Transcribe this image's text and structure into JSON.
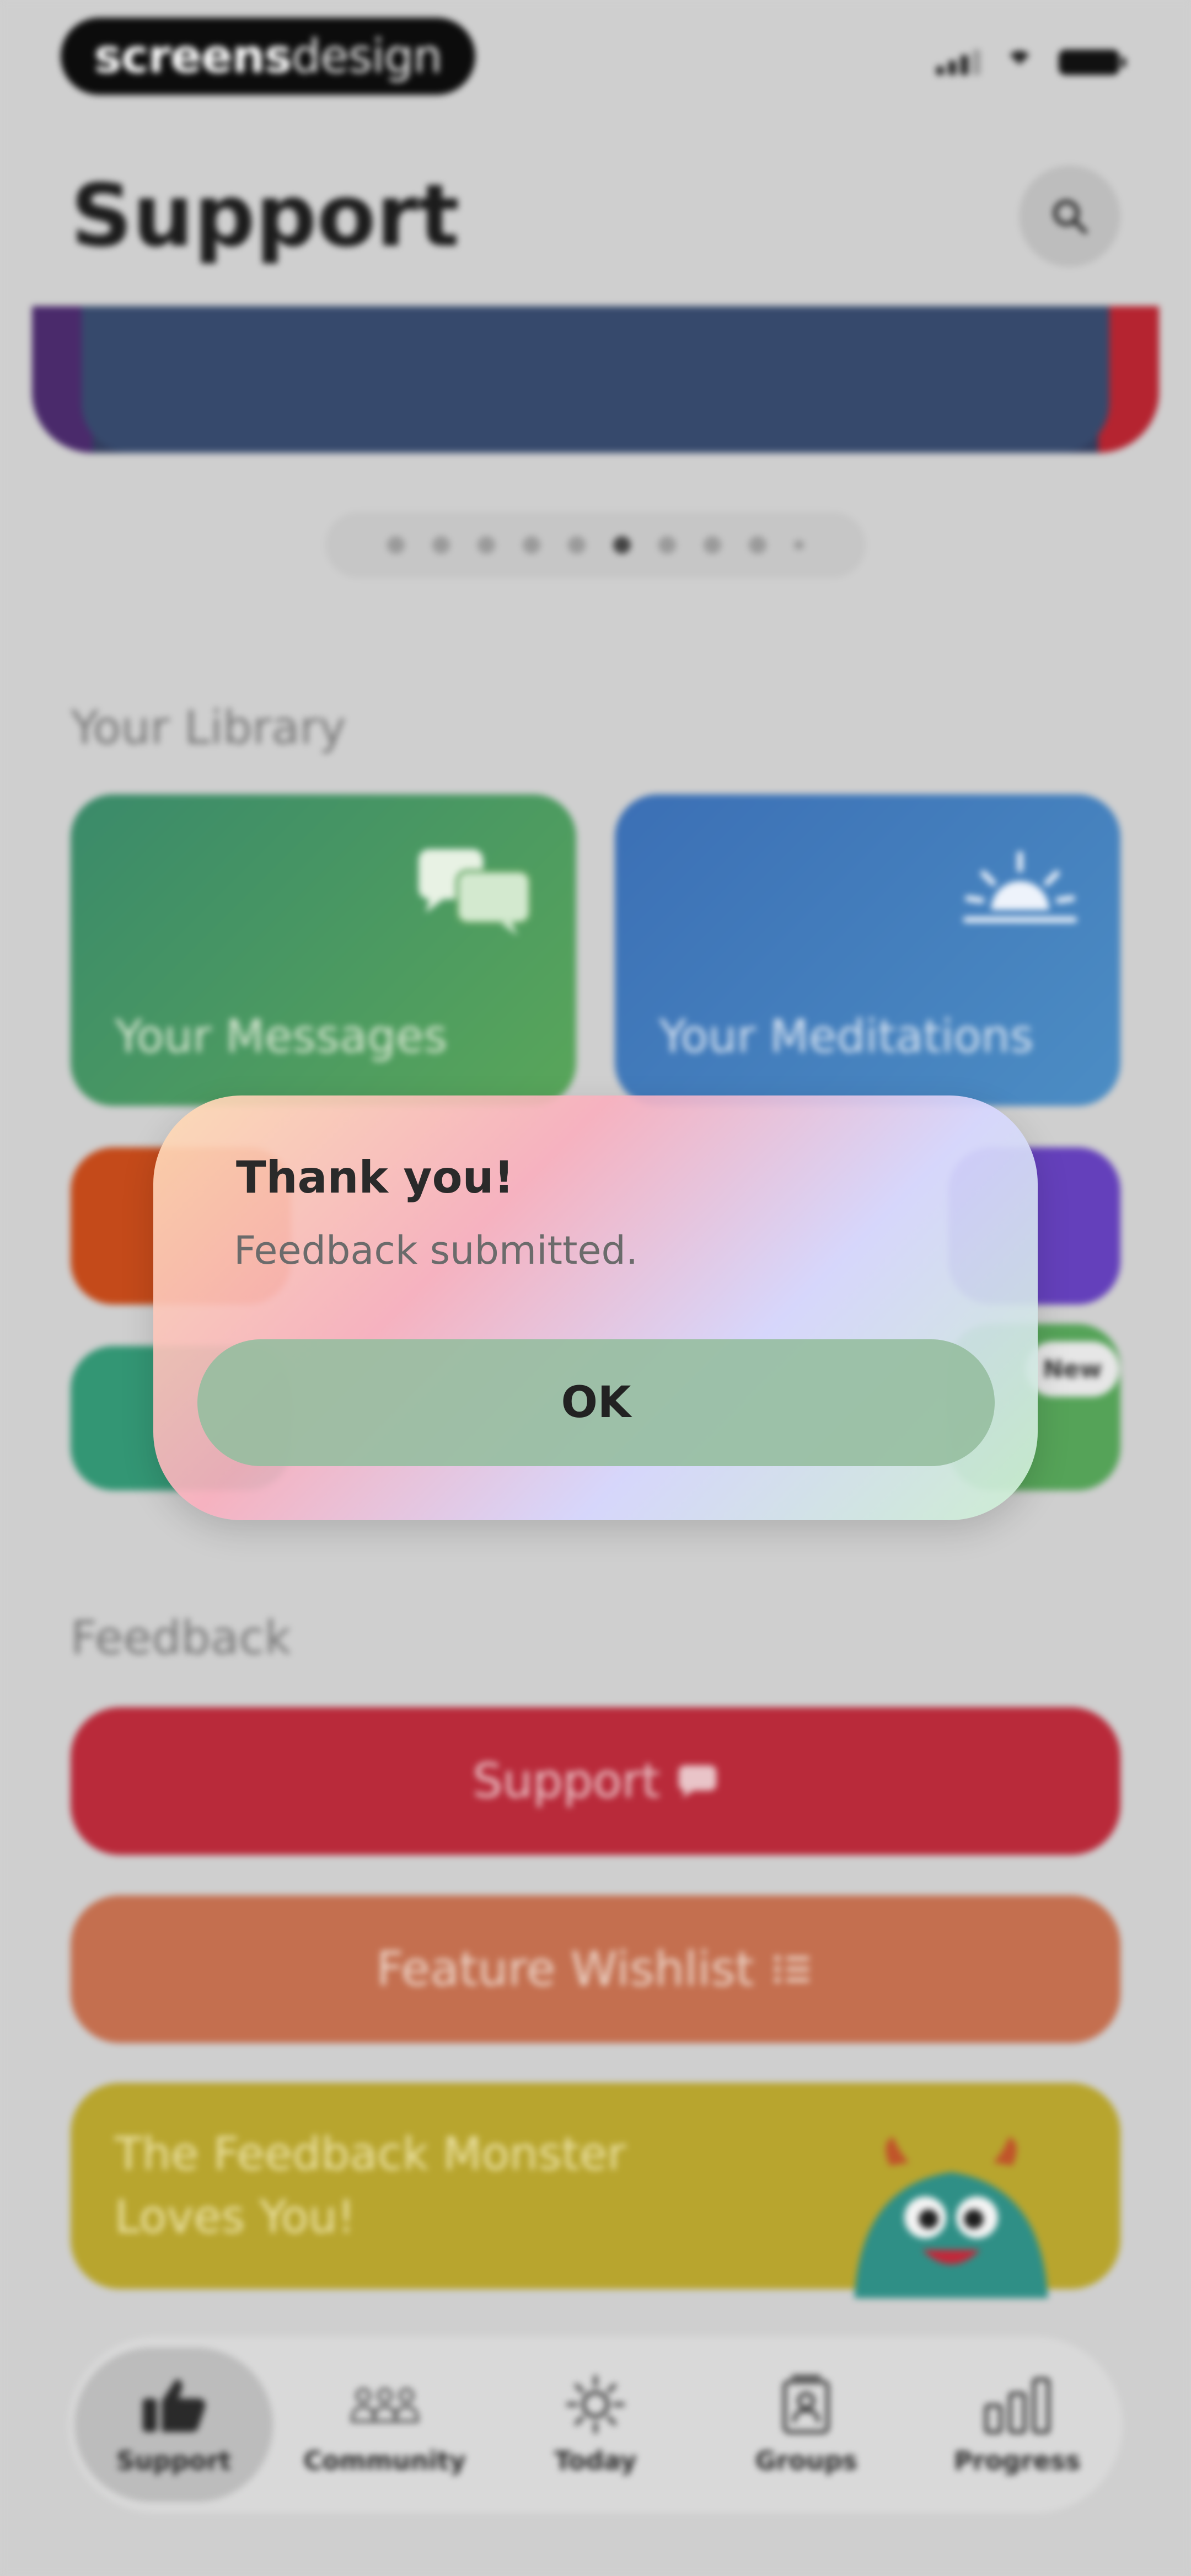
{
  "status_bar": {
    "brand_bold": "screens",
    "brand_light": "design"
  },
  "header": {
    "title": "Support"
  },
  "library": {
    "label": "Your Library",
    "messages_label": "Your Messages",
    "meditations_label": "Your Meditations",
    "new_badge": "New"
  },
  "feedback": {
    "label": "Feedback",
    "support_label": "Support",
    "wishlist_label": "Feature Wishlist",
    "monster_label": "The Feedback Monster Loves You!"
  },
  "dialog": {
    "title": "Thank you!",
    "message": "Feedback submitted.",
    "ok_label": "OK"
  },
  "tabs": [
    {
      "label": "Support",
      "active": true
    },
    {
      "label": "Community",
      "active": false
    },
    {
      "label": "Today",
      "active": false
    },
    {
      "label": "Groups",
      "active": false
    },
    {
      "label": "Progress",
      "active": false
    }
  ],
  "colors": {
    "support_red": "#b92a3a",
    "wishlist_orange": "#c46f4f",
    "monster_yellow": "#b8a52e",
    "messages_green": "#4f9a5f",
    "meditations_blue": "#437ebd"
  },
  "carousel": {
    "page_count": 10,
    "current_page": 6
  }
}
